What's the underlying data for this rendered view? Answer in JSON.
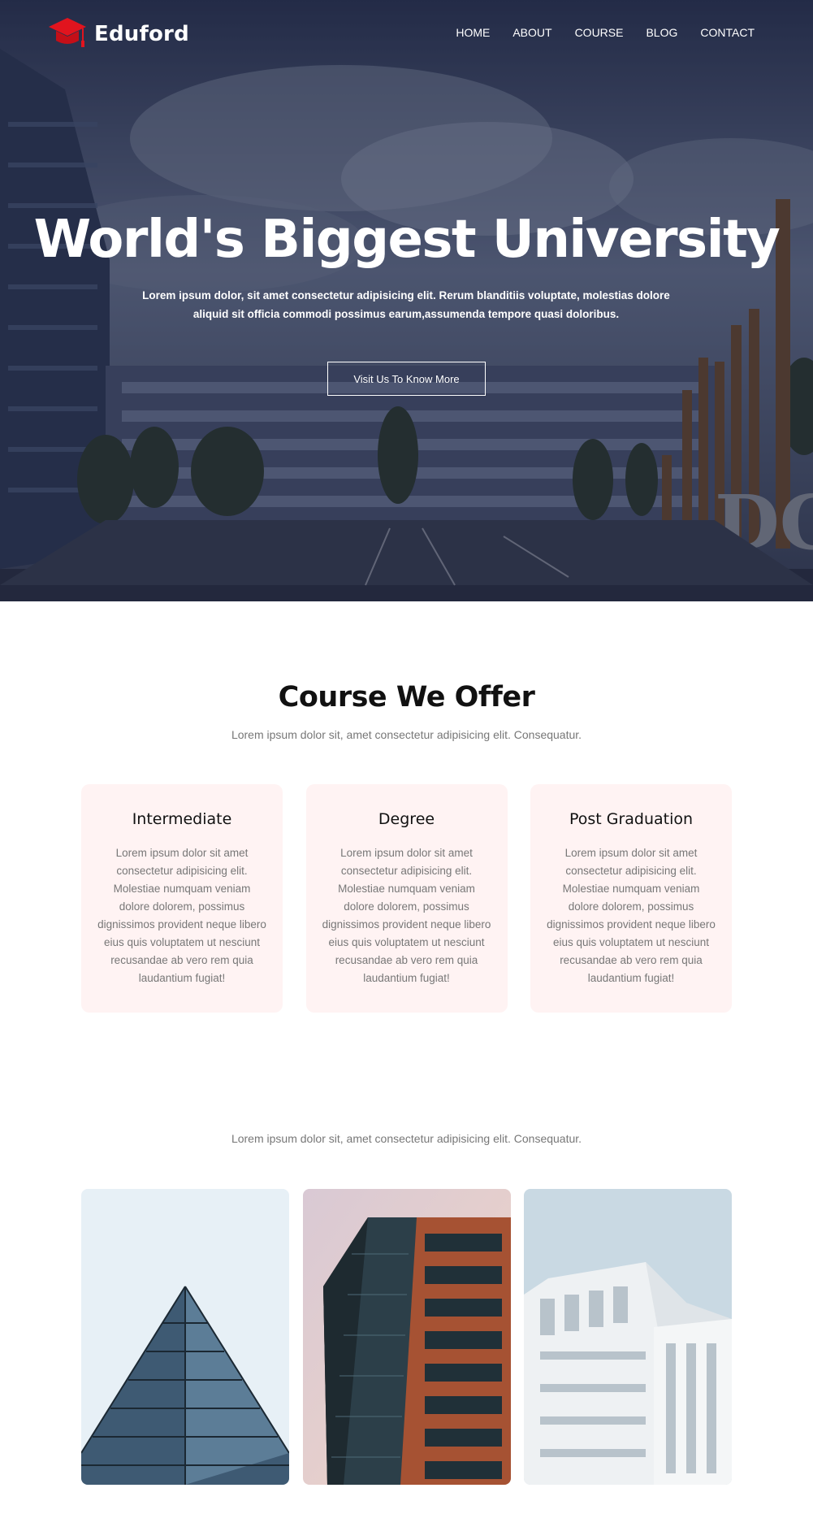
{
  "brand": {
    "name": "Eduford",
    "accent": "#e1141e"
  },
  "nav": {
    "items": [
      "HOME",
      "ABOUT",
      "COURSE",
      "BLOG",
      "CONTACT"
    ]
  },
  "hero": {
    "title": "World's Biggest University",
    "subtitle": "Lorem ipsum dolor, sit amet consectetur adipisicing elit. Rerum blanditiis voluptate, molestias dolore aliquid sit officia commodi possimus earum,assumenda tempore quasi doloribus.",
    "cta": "Visit Us To Know More"
  },
  "courses": {
    "title": "Course We Offer",
    "subtitle": "Lorem ipsum dolor sit, amet consectetur adipisicing elit. Consequatur.",
    "items": [
      {
        "title": "Intermediate",
        "text": "Lorem ipsum dolor sit amet consectetur adipisicing elit. Molestiae numquam veniam dolore dolorem, possimus dignissimos provident neque libero eius quis voluptatem ut nesciunt recusandae ab vero rem quia laudantium fugiat!"
      },
      {
        "title": "Degree",
        "text": "Lorem ipsum dolor sit amet consectetur adipisicing elit. Molestiae numquam veniam dolore dolorem, possimus dignissimos provident neque libero eius quis voluptatem ut nesciunt recusandae ab vero rem quia laudantium fugiat!"
      },
      {
        "title": "Post Graduation",
        "text": "Lorem ipsum dolor sit amet consectetur adipisicing elit. Molestiae numquam veniam dolore dolorem, possimus dignissimos provident neque libero eius quis voluptatem ut nesciunt recusandae ab vero rem quia laudantium fugiat!"
      }
    ],
    "card_bg": "#fff3f3"
  },
  "gallery": {
    "subtitle": "Lorem ipsum dolor sit, amet consectetur adipisicing elit. Consequatur.",
    "images": [
      "glass-pyramid-building",
      "red-frame-glass-tower",
      "white-modern-building"
    ]
  }
}
